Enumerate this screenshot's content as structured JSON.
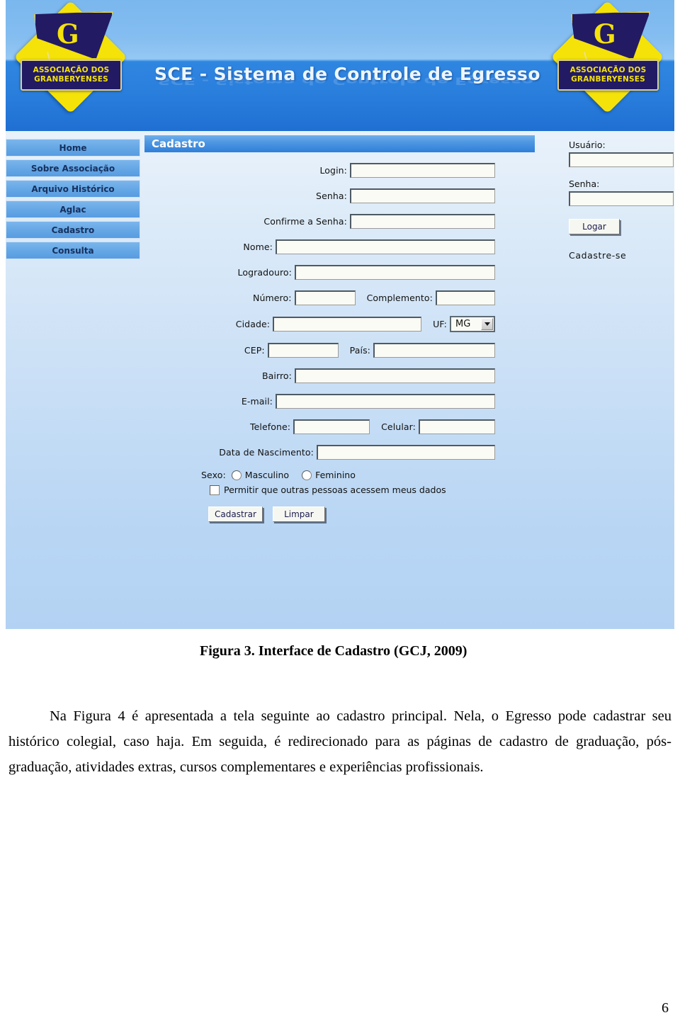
{
  "banner": {
    "title": "SCE - Sistema de Controle de Egresso",
    "logo_line1": "ASSOCIAÇÃO DOS",
    "logo_line2": "GRANBERYENSES",
    "logo_letter": "G"
  },
  "sidebar": {
    "items": [
      {
        "label": "Home"
      },
      {
        "label": "Sobre Associação"
      },
      {
        "label": "Arquivo Histórico"
      },
      {
        "label": "Aglac"
      },
      {
        "label": "Cadastro"
      },
      {
        "label": "Consulta"
      }
    ]
  },
  "form": {
    "panel_title": "Cadastro",
    "fields": {
      "login": "Login:",
      "senha": "Senha:",
      "confirme_senha": "Confirme a Senha:",
      "nome": "Nome:",
      "logradouro": "Logradouro:",
      "numero": "Número:",
      "complemento": "Complemento:",
      "cidade": "Cidade:",
      "uf": "UF:",
      "cep": "CEP:",
      "pais": "País:",
      "bairro": "Bairro:",
      "email": "E-mail:",
      "telefone": "Telefone:",
      "celular": "Celular:",
      "data_nascimento": "Data de Nascimento:",
      "sexo": "Sexo:"
    },
    "values": {
      "login": "",
      "senha": "",
      "confirme_senha": "",
      "nome": "",
      "logradouro": "",
      "numero": "",
      "complemento": "",
      "cidade": "",
      "uf_selected": "MG",
      "cep": "",
      "pais": "",
      "bairro": "",
      "email": "",
      "telefone": "",
      "celular": "",
      "data_nascimento": ""
    },
    "radio_masculino": "Masculino",
    "radio_feminino": "Feminino",
    "permission_checkbox": "Permitir que outras pessoas acessem meus dados",
    "submit_label": "Cadastrar",
    "clear_label": "Limpar"
  },
  "login_panel": {
    "usuario_label": "Usuário:",
    "senha_label": "Senha:",
    "usuario_value": "",
    "senha_value": "",
    "login_button": "Logar",
    "signup_link": "Cadastre-se"
  },
  "document": {
    "caption": "Figura 3. Interface de Cadastro (GCJ, 2009)",
    "paragraph": "Na Figura 4 é apresentada a tela seguinte ao cadastro principal. Nela, o Egresso pode cadastrar seu histórico colegial, caso haja. Em seguida, é redirecionado para as páginas de cadastro de graduação, pós-graduação, atividades extras, cursos complementares e experiências profissionais.",
    "page_number": "6"
  },
  "colors": {
    "banner_top": "#7ab7ee",
    "banner_bottom": "#1f6fd2",
    "panel_title_bg": "#2f7fd8",
    "nav_button": "#68a9e6",
    "logo_yellow": "#f5e209",
    "logo_navy": "#221a63",
    "body_bg": "#cbe0f6"
  }
}
